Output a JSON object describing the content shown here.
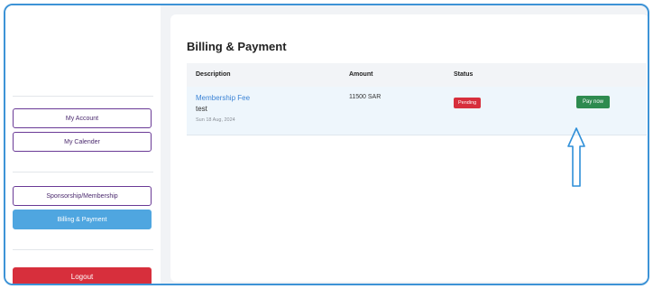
{
  "sidebar": {
    "my_account": "My Account",
    "my_calendar": "My Calender",
    "sponsorship": "Sponsorship/Membership",
    "billing": "Billing & Payment",
    "logout": "Logout"
  },
  "main": {
    "title": "Billing & Payment",
    "table": {
      "columns": [
        "Description",
        "Amount",
        "Status"
      ],
      "rows": [
        {
          "description": "Membership Fee",
          "subtitle": "test",
          "date": "Sun 18 Aug, 2024",
          "amount": "11500 SAR",
          "status": "Pending",
          "action": "Pay now"
        }
      ]
    }
  },
  "annotation": {
    "icon": "up-arrow-icon",
    "color": "#2f8fd8"
  },
  "colors": {
    "accent": "#4fa6e0",
    "danger": "#d72f3c",
    "success": "#2e8b4f",
    "frame": "#3d93d6"
  }
}
